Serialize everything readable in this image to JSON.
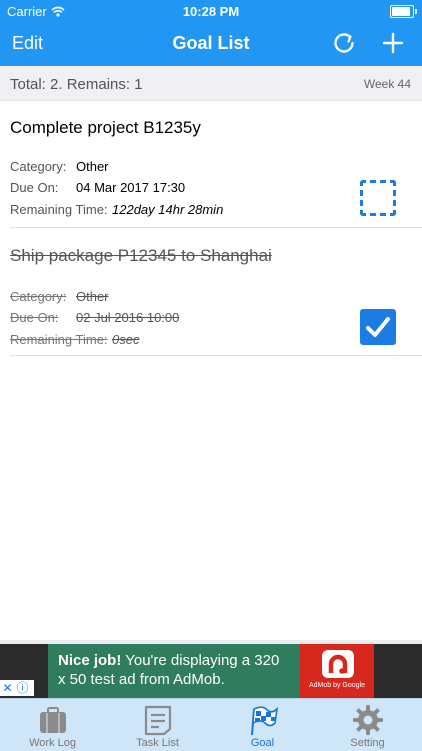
{
  "status_bar": {
    "carrier": "Carrier",
    "time": "10:28 PM",
    "battery_level": 1.0
  },
  "navbar": {
    "edit_label": "Edit",
    "title": "Goal List",
    "refresh_icon": "refresh-icon",
    "add_icon": "plus-icon"
  },
  "summary": {
    "totals": "Total: 2.  Remains: 1",
    "week": "Week 44"
  },
  "labels": {
    "category": "Category:",
    "due_on": "Due On:",
    "remaining_time": "Remaining  Time:"
  },
  "goals": [
    {
      "name": "Complete project B1235y",
      "category": "Other",
      "due_on": "04 Mar 2017  17:30",
      "remaining": "122day 14hr 28min",
      "completed": false
    },
    {
      "name": "Ship package P12345 to Shanghai",
      "category": "Other",
      "due_on": "02 Jul 2016  10:00",
      "remaining": "0sec",
      "completed": true
    }
  ],
  "ad": {
    "headline": "Nice job!",
    "body": " You're displaying a 320 x 50 test ad from AdMob.",
    "brand": "AdMob by Google"
  },
  "tabs": [
    {
      "label": "Work Log",
      "icon": "briefcase-icon",
      "active": false
    },
    {
      "label": "Task List",
      "icon": "task-list-icon",
      "active": false
    },
    {
      "label": "Goal",
      "icon": "checkered-flag-icon",
      "active": true
    },
    {
      "label": "Setting",
      "icon": "gear-icon",
      "active": false
    }
  ],
  "colors": {
    "primary": "#2196f3",
    "checkbox": "#1b7ce3",
    "tabbar": "#cfe6f8",
    "tab_active": "#1976d2",
    "ad_bg": "#2f7c5f"
  }
}
